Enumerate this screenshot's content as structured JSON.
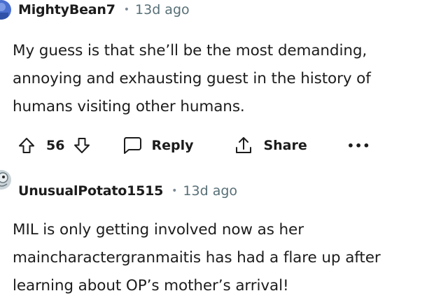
{
  "comments": [
    {
      "username": "MightyBean7",
      "separator": "•",
      "time": "13d ago",
      "body_lines": [
        "My guess is that she’ll be the most demanding,",
        "annoying and exhausting guest in the history of",
        "humans visiting other humans."
      ],
      "score": "56",
      "reply_label": "Reply",
      "share_label": "Share",
      "more_label": "•••",
      "icons": [
        "upvote-icon",
        "downvote-icon",
        "comment-bubble-icon",
        "share-icon",
        "more-options-icon"
      ]
    },
    {
      "username": "UnusualPotato1515",
      "separator": "•",
      "time": "13d ago",
      "body_lines": [
        "MIL is only getting involved now as her",
        "maincharactergranmaitis has had a flare up after",
        "learning about OP’s mother’s arrival!"
      ]
    }
  ],
  "colors": {
    "text": "#1c1c1c",
    "meta": "#576f76",
    "avatar1": "#5b7fd6",
    "avatar2": "#b8c6cc"
  }
}
